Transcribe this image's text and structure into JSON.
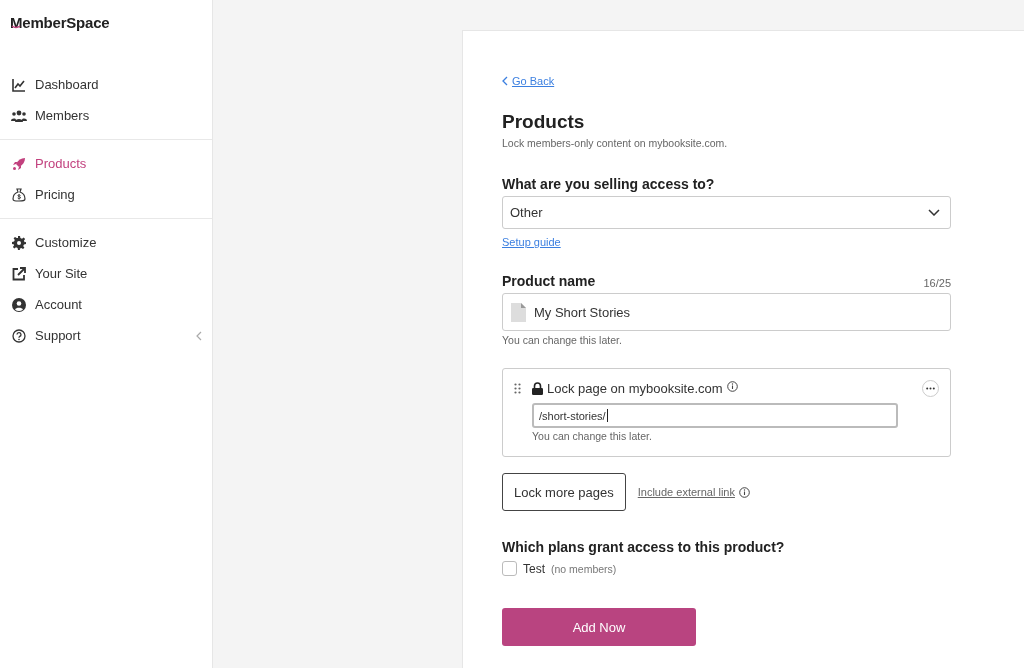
{
  "sidebar": {
    "logo": "MemberSpace",
    "groups": [
      {
        "items": [
          {
            "label": "Dashboard",
            "selected": false,
            "kind": "link"
          },
          {
            "label": "Members",
            "selected": false,
            "kind": "link"
          }
        ]
      },
      {
        "items": [
          {
            "label": "Products",
            "selected": true,
            "kind": "link"
          },
          {
            "label": "Pricing",
            "selected": false,
            "kind": "link"
          }
        ]
      },
      {
        "items": [
          {
            "label": "Customize",
            "selected": false,
            "kind": "link"
          },
          {
            "label": "Your Site",
            "selected": false,
            "kind": "link"
          },
          {
            "label": "Account",
            "selected": false,
            "kind": "link"
          },
          {
            "label": "Support",
            "selected": false,
            "kind": "submenu"
          }
        ]
      }
    ]
  },
  "main": {
    "go_back": "Go Back",
    "title": "Products",
    "subtitle": "Lock members-only content on mybooksite.com.",
    "access": {
      "label": "What are you selling access to?",
      "value": "Other",
      "link": "Setup guide"
    },
    "product_name": {
      "label": "Product name",
      "count": "16/25",
      "value": "My Short Stories",
      "hint": "You can change this later."
    },
    "lock_page": {
      "label": "Lock page on mybooksite.com",
      "value": "/short-stories/",
      "hint": "You can change this later."
    },
    "lock_more": "Lock more pages",
    "external_link": "Include external link",
    "plans": {
      "label": "Which plans grant access to this product?",
      "items": [
        {
          "name": "Test",
          "note": "(no members)",
          "checked": false
        }
      ]
    },
    "submit": "Add Now"
  }
}
